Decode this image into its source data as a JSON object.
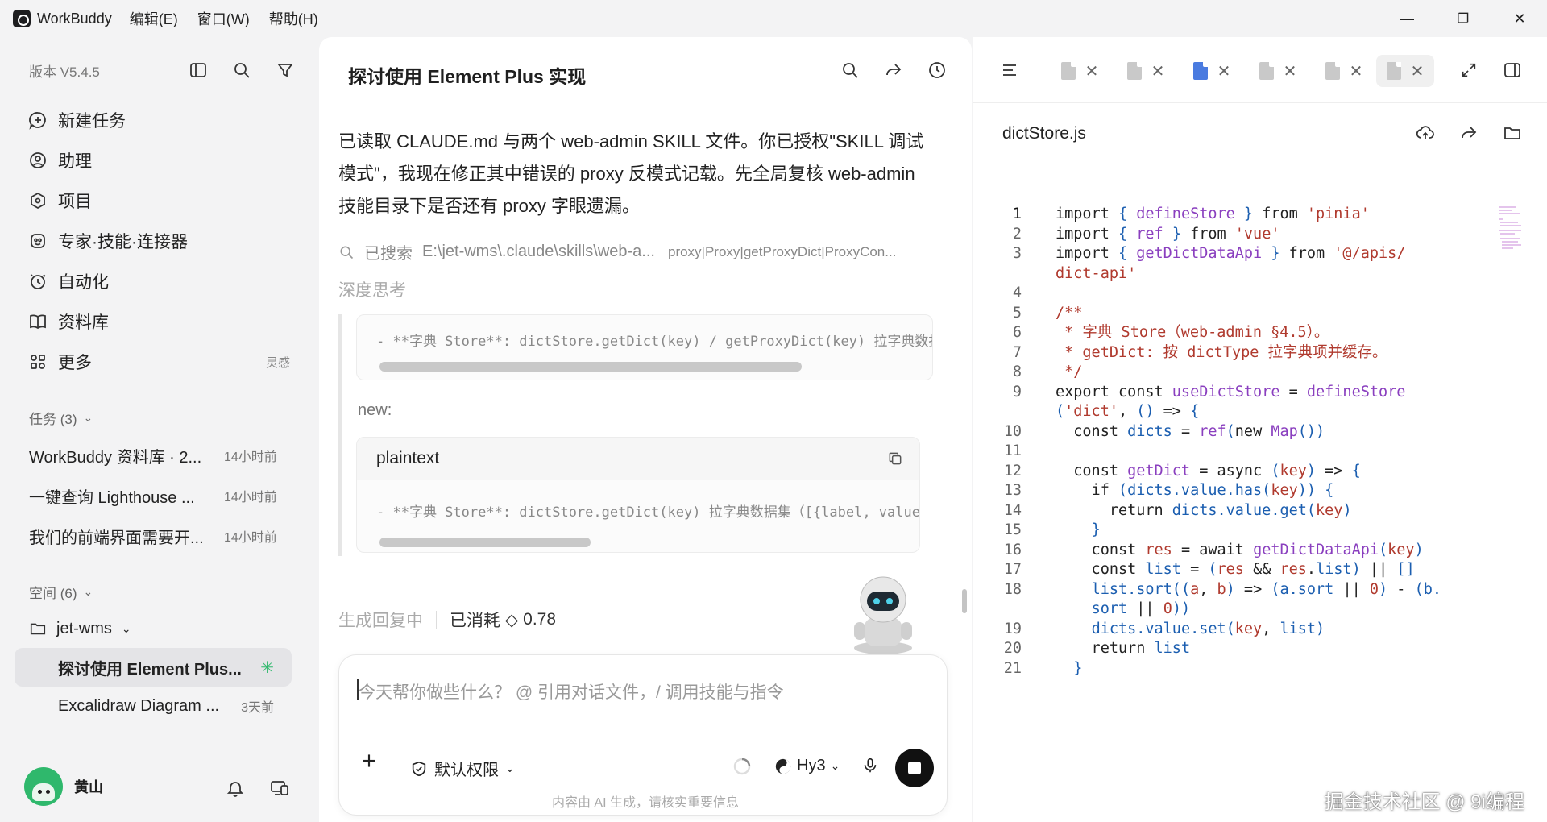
{
  "titlebar": {
    "app_name": "WorkBuddy",
    "menus": [
      "编辑(E)",
      "窗口(W)",
      "帮助(H)"
    ],
    "minimize": "—",
    "restore": "❐",
    "close": "✕"
  },
  "sidebar": {
    "version": "版本 V5.4.5",
    "nav": [
      {
        "label": "新建任务",
        "icon": "new-task-icon"
      },
      {
        "label": "助理",
        "icon": "assistant-icon"
      },
      {
        "label": "项目",
        "icon": "project-icon"
      },
      {
        "label": "专家·技能·连接器",
        "icon": "expert-icon"
      },
      {
        "label": "自动化",
        "icon": "automation-icon"
      },
      {
        "label": "资料库",
        "icon": "library-icon"
      },
      {
        "label": "更多",
        "icon": "more-icon",
        "tag": "灵感"
      }
    ],
    "tasks_header": "任务 (3)",
    "tasks": [
      {
        "title": "WorkBuddy 资料库 · 2...",
        "time": "14小时前"
      },
      {
        "title": "一键查询 Lighthouse ...",
        "time": "14小时前"
      },
      {
        "title": "我们的前端界面需要开...",
        "time": "14小时前"
      }
    ],
    "spaces_header": "空间 (6)",
    "space_name": "jet-wms",
    "space_items": [
      {
        "title": "探讨使用 Element Plus...",
        "time": ""
      },
      {
        "title": "Excalidraw Diagram ...",
        "time": "3天前"
      }
    ],
    "user_name": "黄山"
  },
  "chat": {
    "title": "探讨使用 Element Plus 实现",
    "message": "已读取 CLAUDE.md 与两个 web-admin SKILL 文件。你已授权\"SKILL 调试模式\"，我现在修正其中错误的 proxy 反模式记载。先全局复核 web-admin 技能目录下是否还有 proxy 字眼遗漏。",
    "search_label": "已搜索",
    "search_path": "E:\\jet-wms\\.claude\\skills\\web-a...",
    "search_keywords": "proxy|Proxy|getProxyDict|ProxyCon...",
    "thinking": "深度思考",
    "old_code_line": "- **字典 Store**: dictStore.getDict(key) / getProxyDict(key) 拉字典数据集",
    "new_label": "new:",
    "new_lang": "plaintext",
    "new_code_line": "- **字典 Store**: dictStore.getDict(key) 拉字典数据集（[{label, value}]）",
    "status_generating": "生成回复中",
    "status_cost_label": "已消耗",
    "status_cost_value": "0.78",
    "input_placeholder": "今天帮你做些什么？ @ 引用对话文件，/ 调用技能与指令",
    "permission_label": "默认权限",
    "model_label": "Hy3",
    "disclaimer": "内容由 AI 生成，请核实重要信息"
  },
  "editor": {
    "filename": "dictStore.js",
    "watermark": "掘金技术社区 @ 9i编程",
    "tab_close": "✕"
  }
}
